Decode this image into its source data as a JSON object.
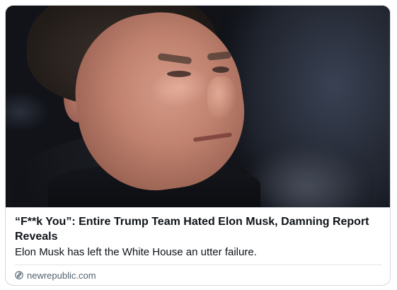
{
  "card": {
    "title": "“F**k You”: Entire Trump Team Hated Elon Musk, Damning Report Reveals",
    "description": "Elon Musk has left the White House an utter failure.",
    "source_domain": "newrepublic.com",
    "source_icon": "link-icon"
  }
}
